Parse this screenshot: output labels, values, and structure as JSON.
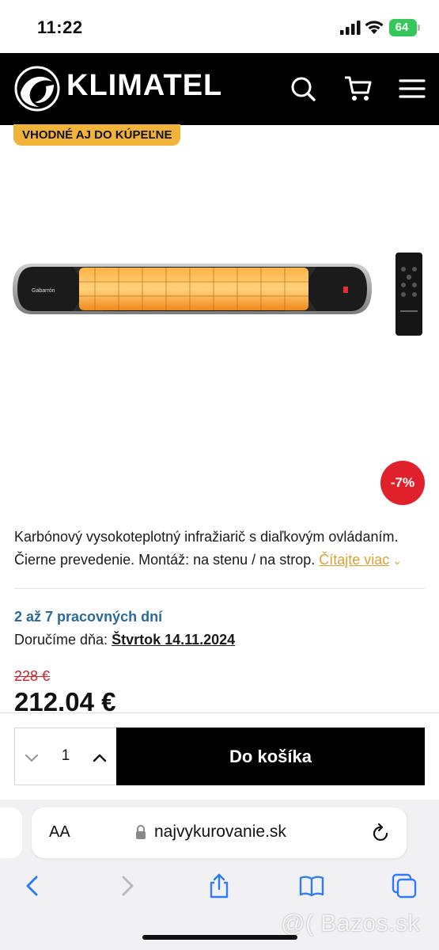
{
  "status_bar": {
    "time": "11:22",
    "battery": "64"
  },
  "header": {
    "brand": "KLIMATEL"
  },
  "product": {
    "badge": "VHODNÉ AJ DO KÚPEĽNE",
    "image_brand": "Gabarrón",
    "discount": "-7%",
    "description_line1": "Karbónový vysokoteplotný infražiarič s diaľkovým ovládaním.",
    "description_line2": "Čierne prevedenie. Montáž: na stenu / na strop.",
    "read_more": "Čítajte viac",
    "delivery_days": "2 až 7 pracovných dní",
    "delivery_label": "Doručíme dňa:",
    "delivery_date": "Štvrtok 14.11.2024",
    "old_price": "228 €",
    "price": "212.04 €"
  },
  "cart": {
    "quantity": "1",
    "add_label": "Do košíka"
  },
  "browser": {
    "text_size": "AA",
    "url": "najvykurovanie.sk"
  },
  "watermark": "@( Bazos.sk",
  "colors": {
    "accent": "#f2b33a",
    "sale": "#e0202a",
    "link_blue": "#2a6a9a"
  }
}
